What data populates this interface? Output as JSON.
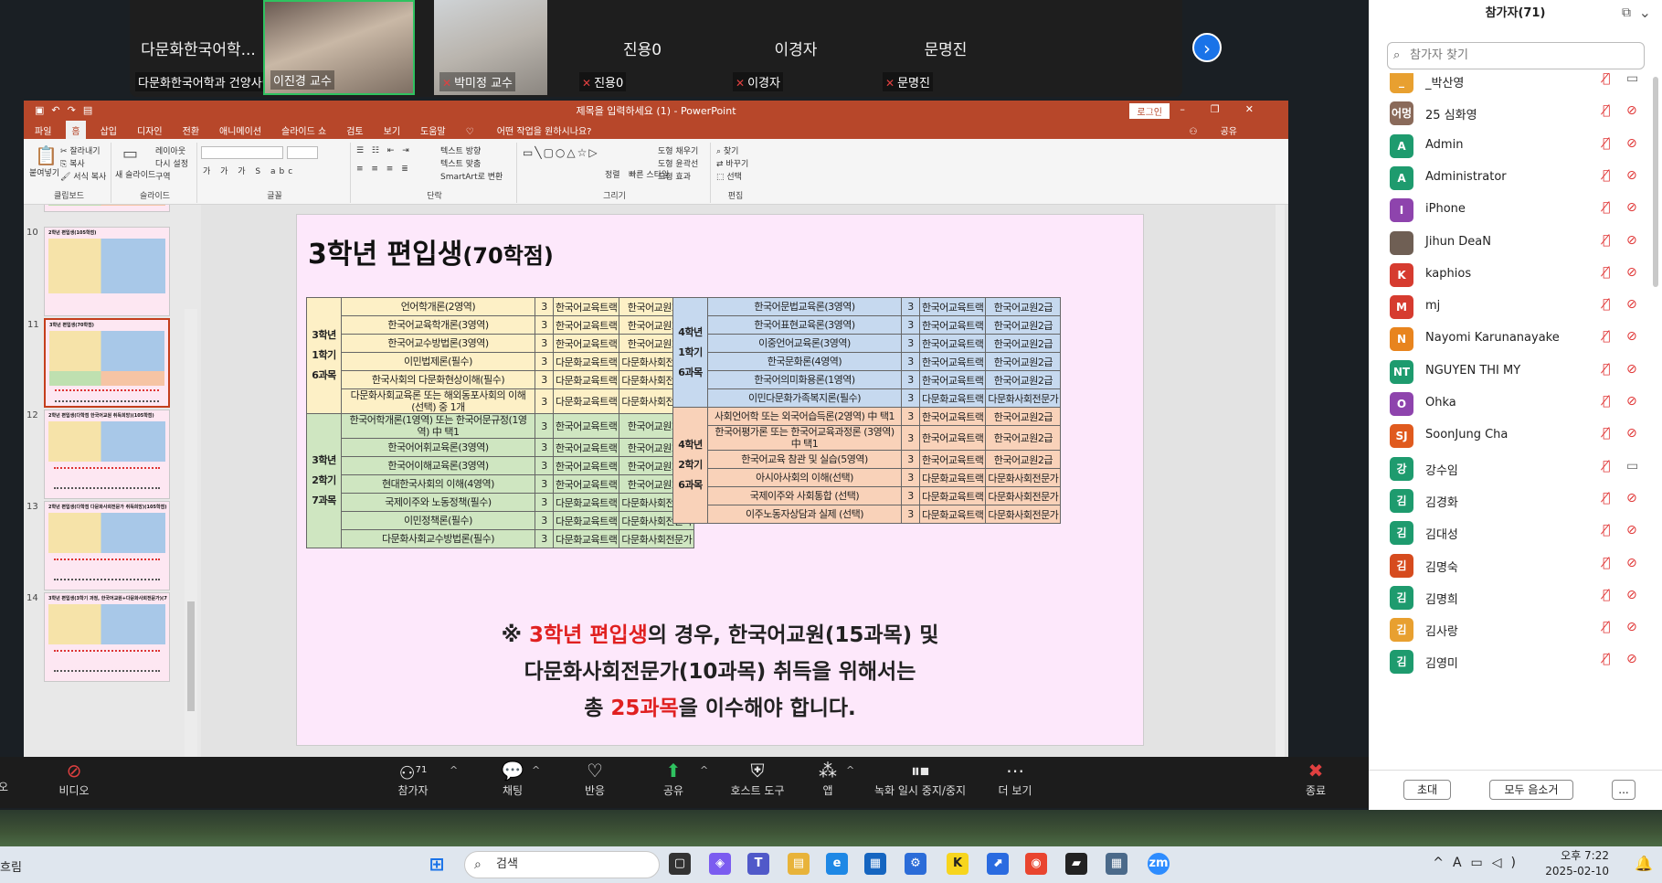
{
  "strip": {
    "tiles": [
      {
        "big": "다문화한국어학...",
        "name": "다문화한국어학과 건양사이버..."
      },
      {
        "big": "",
        "name": "이진경 교수"
      },
      {
        "big": "",
        "name": "박미정 교수"
      },
      {
        "big": "진용0",
        "name": "진용0"
      },
      {
        "big": "이경자",
        "name": "이경자"
      },
      {
        "big": "문명진",
        "name": "문명진"
      }
    ],
    "next_icon": "chevron-right-icon"
  },
  "ppt": {
    "title": "제목을 입력하세요 (1) - PowerPoint",
    "login": "로그인",
    "menu": [
      "파일",
      "홈",
      "삽입",
      "디자인",
      "전환",
      "애니메이션",
      "슬라이드 쇼",
      "검토",
      "보기",
      "도움말",
      "어떤 작업을 원하시나요?"
    ],
    "share": "공유",
    "ribbon": {
      "clipboard": {
        "paste": "붙여넣기",
        "cut": "잘라내기",
        "copy": "복사",
        "format": "서식 복사",
        "label": "클립보드"
      },
      "slides": {
        "new": "새 슬라이드",
        "layout": "레이아웃",
        "reset": "다시 설정",
        "section": "구역",
        "label": "슬라이드"
      },
      "font_label": "글꼴",
      "paragraph": {
        "dir": "텍스트 방향",
        "align": "텍스트 맞춤",
        "smartart": "SmartArt로 변환",
        "label": "단락"
      },
      "drawing": {
        "arrange": "정렬",
        "styles": "빠른 스타일",
        "fill": "도형 채우기",
        "outline": "도형 윤곽선",
        "effect": "도형 효과",
        "label": "그리기"
      },
      "editing": {
        "find": "찾기",
        "replace": "바꾸기",
        "select": "선택",
        "label": "편집"
      }
    },
    "thumbs": [
      {
        "num": "10",
        "title": "2학년 편입생(105학점)"
      },
      {
        "num": "11",
        "title": "3학년 편입생(70학점)"
      },
      {
        "num": "12",
        "title": "2학년 편입생(다학점 한국어교원 취득희망)(105학점)"
      },
      {
        "num": "13",
        "title": "2학년 편입생(다학점 다문화사회전문가 취득희망)(105학점)"
      },
      {
        "num": "14",
        "title": "3학년 편입생(3학기 과정, 한국어교원+다문화사회전문가)(70학점)"
      }
    ],
    "slide": {
      "title": "3학년 편입생",
      "title_sub": "(70학점)",
      "left": [
        {
          "sem": "3학년 1학기 6과목",
          "cls": "y",
          "rows": [
            [
              "언어학개론(2영역)",
              "3",
              "한국어교육트랙",
              "한국어교원2급"
            ],
            [
              "한국어교육학개론(3영역)",
              "3",
              "한국어교육트랙",
              "한국어교원2급"
            ],
            [
              "한국어교수방법론(3영역)",
              "3",
              "한국어교육트랙",
              "한국어교원2급"
            ],
            [
              "이민법제론(필수)",
              "3",
              "다문화교육트랙",
              "다문화사회전문가"
            ],
            [
              "한국사회의 다문화현상이해(필수)",
              "3",
              "다문화교육트랙",
              "다문화사회전문가"
            ],
            [
              "다문화사회교육론 또는 해외동포사회의 이해 (선택) 중 1개",
              "3",
              "다문화교육트랙",
              "다문화사회전문가"
            ]
          ]
        },
        {
          "sem": "3학년 2학기 7과목",
          "cls": "g",
          "rows": [
            [
              "한국어학개론(1영역) 또는 한국어문규정(1영역) 中 택1",
              "3",
              "한국어교육트랙",
              "한국어교원2급"
            ],
            [
              "한국어어휘교육론(3영역)",
              "3",
              "한국어교육트랙",
              "한국어교원2급"
            ],
            [
              "한국어이해교육론(3영역)",
              "3",
              "한국어교육트랙",
              "한국어교원2급"
            ],
            [
              "현대한국사회의 이해(4영역)",
              "3",
              "한국어교육트랙",
              "한국어교원2급"
            ],
            [
              "국제이주와 노동정책(필수)",
              "3",
              "다문화교육트랙",
              "다문화사회전문가"
            ],
            [
              "이민정책론(필수)",
              "3",
              "다문화교육트랙",
              "다문화사회전문가"
            ],
            [
              "다문화사회교수방법론(필수)",
              "3",
              "다문화교육트랙",
              "다문화사회전문가"
            ]
          ]
        }
      ],
      "right": [
        {
          "sem": "4학년 1학기 6과목",
          "cls": "b",
          "rows": [
            [
              "한국어문법교육론(3영역)",
              "3",
              "한국어교육트랙",
              "한국어교원2급"
            ],
            [
              "한국어표현교육론(3영역)",
              "3",
              "한국어교육트랙",
              "한국어교원2급"
            ],
            [
              "이중언어교육론(3영역)",
              "3",
              "한국어교육트랙",
              "한국어교원2급"
            ],
            [
              "한국문화론(4영역)",
              "3",
              "한국어교육트랙",
              "한국어교원2급"
            ],
            [
              "한국어의미화용론(1영역)",
              "3",
              "한국어교육트랙",
              "한국어교원2급"
            ],
            [
              "이민다문화가족복지론(필수)",
              "3",
              "다문화교육트랙",
              "다문화사회전문가"
            ]
          ]
        },
        {
          "sem": "4학년 2학기 6과목",
          "cls": "o",
          "rows": [
            [
              "사회언어학 또는 외국어습득론(2영역) 中 택1",
              "3",
              "한국어교육트랙",
              "한국어교원2급"
            ],
            [
              "한국어평가론 또는 한국어교육과정론 (3영역) 中 택1",
              "3",
              "한국어교육트랙",
              "한국어교원2급"
            ],
            [
              "한국어교육 참관 및 실습(5영역)",
              "3",
              "한국어교육트랙",
              "한국어교원2급"
            ],
            [
              "아시아사회의 이해(선택)",
              "3",
              "다문화교육트랙",
              "다문화사회전문가"
            ],
            [
              "국제이주와 사회통합 (선택)",
              "3",
              "다문화교육트랙",
              "다문화사회전문가"
            ],
            [
              "이주노동자상담과 실제 (선택)",
              "3",
              "다문화교육트랙",
              "다문화사회전문가"
            ]
          ]
        }
      ],
      "note": {
        "mark": "※ ",
        "red1": "3학년 편입생",
        "t1": "의 경우, 한국어교원(15과목) 및",
        "t2": "다문화사회전문가(10과목) 취득을 위해서는",
        "t3a": "총 ",
        "red2": "25과목",
        "t3b": "을 이수해야 합니다."
      }
    }
  },
  "toolbar": {
    "video": "비디오",
    "participants": "참가자",
    "participants_count": "71",
    "chat": "채팅",
    "react": "반응",
    "share": "공유",
    "host": "호스트 도구",
    "apps": "앱",
    "record": "녹화 일시 중지/중지",
    "more": "더 보기",
    "end": "종료",
    "left_edge": "오"
  },
  "panel": {
    "title": "참가자(71)",
    "search_placeholder": "참가자 찾기",
    "items": [
      {
        "name": "_박산영",
        "initial": "_",
        "color": "#e8a030",
        "cam": "video"
      },
      {
        "name": "25 심화영",
        "initial": "어멍",
        "color": "#8a6a5a",
        "cam": "off"
      },
      {
        "name": "Admin",
        "initial": "A",
        "color": "#1e9b6e",
        "cam": "off"
      },
      {
        "name": "Administrator",
        "initial": "A",
        "color": "#1e9b6e",
        "cam": "off"
      },
      {
        "name": "iPhone",
        "initial": "I",
        "color": "#8e44ad",
        "cam": "off"
      },
      {
        "name": "Jihun DeaN",
        "initial": "",
        "color": "#6f5f54",
        "cam": "off"
      },
      {
        "name": "kaphios",
        "initial": "K",
        "color": "#d63b2f",
        "cam": "off"
      },
      {
        "name": "mj",
        "initial": "M",
        "color": "#d63b2f",
        "cam": "off"
      },
      {
        "name": "Nayomi Karunanayake",
        "initial": "N",
        "color": "#e8841e",
        "cam": "off"
      },
      {
        "name": "NGUYEN THI MY",
        "initial": "NT",
        "color": "#1e9b6e",
        "cam": "off"
      },
      {
        "name": "Ohka",
        "initial": "O",
        "color": "#8e44ad",
        "cam": "off"
      },
      {
        "name": "SoonJung Cha",
        "initial": "SJ",
        "color": "#e05a1e",
        "cam": "off"
      },
      {
        "name": "강수임",
        "initial": "강",
        "color": "#1e9b6e",
        "cam": "video"
      },
      {
        "name": "김경화",
        "initial": "김",
        "color": "#1e9b6e",
        "cam": "off"
      },
      {
        "name": "김대성",
        "initial": "김",
        "color": "#1e9b6e",
        "cam": "off"
      },
      {
        "name": "김명숙",
        "initial": "김",
        "color": "#d64b1e",
        "cam": "off"
      },
      {
        "name": "김명희",
        "initial": "김",
        "color": "#1e9b6e",
        "cam": "off"
      },
      {
        "name": "김사랑",
        "initial": "김",
        "color": "#e8a030",
        "cam": "off"
      },
      {
        "name": "김영미",
        "initial": "김",
        "color": "#1e9b6e",
        "cam": "off"
      }
    ],
    "invite": "초대",
    "mute_all": "모두 음소거",
    "more": "..."
  },
  "taskbar": {
    "left": "흐림",
    "search": "검색",
    "time": "오후 7:22",
    "date": "2025-02-10"
  },
  "colors": {
    "ppt": "#b7472a",
    "zoom_blue": "#1a73e8",
    "red": "#e02020"
  }
}
